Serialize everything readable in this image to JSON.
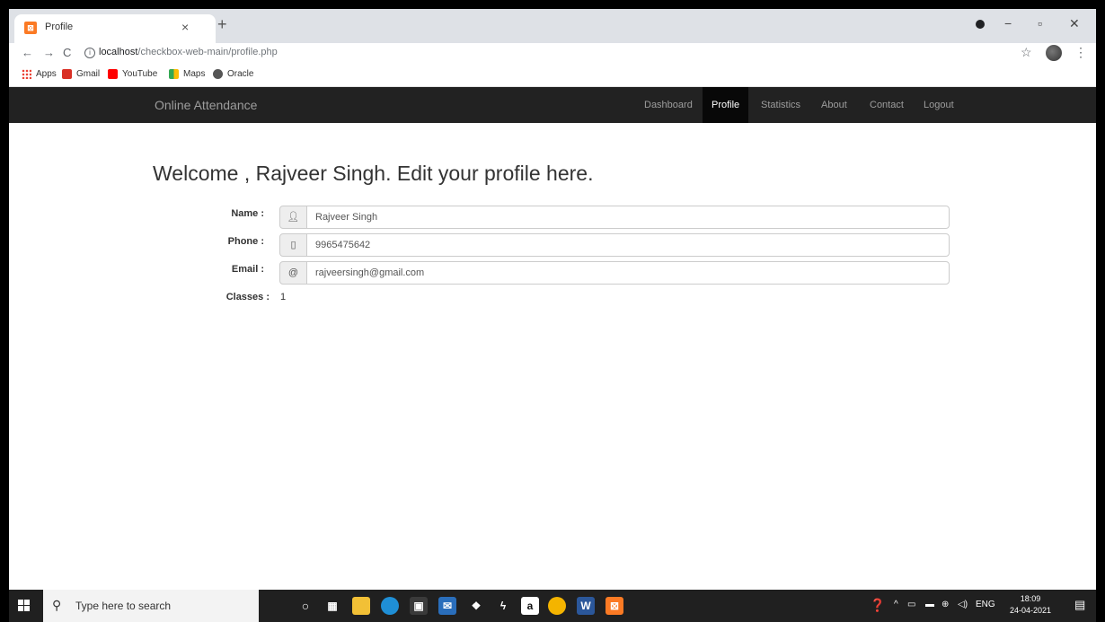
{
  "browser": {
    "tab_title": "Profile",
    "tab_favicon": "xampp-icon",
    "tab_close": "×",
    "new_tab": "+",
    "url_host": "localhost",
    "url_path": "/checkbox-web-main/profile.php",
    "bookmarks": [
      "Apps",
      "Gmail",
      "YouTube",
      "Maps",
      "Oracle"
    ]
  },
  "navbar": {
    "brand": "Online Attendance",
    "items": [
      "Dashboard",
      "Profile",
      "Statistics",
      "About",
      "Contact",
      "Logout"
    ],
    "active": "Profile"
  },
  "profile": {
    "heading": "Welcome , Rajveer Singh. Edit your profile here.",
    "name_label": "Name :",
    "name_value": "Rajveer Singh",
    "phone_label": "Phone :",
    "phone_value": "9965475642",
    "email_label": "Email :",
    "email_addon": "@",
    "email_value": "rajveersingh@gmail.com",
    "classes_label": "Classes :",
    "classes_value": "1"
  },
  "taskbar": {
    "search_placeholder": "Type here to search",
    "lang": "ENG",
    "time": "18:09",
    "date": "24-04-2021"
  },
  "colors": {
    "navbar_bg": "#222222",
    "navbar_active_bg": "#080808",
    "taskbar_bg": "#202020"
  }
}
